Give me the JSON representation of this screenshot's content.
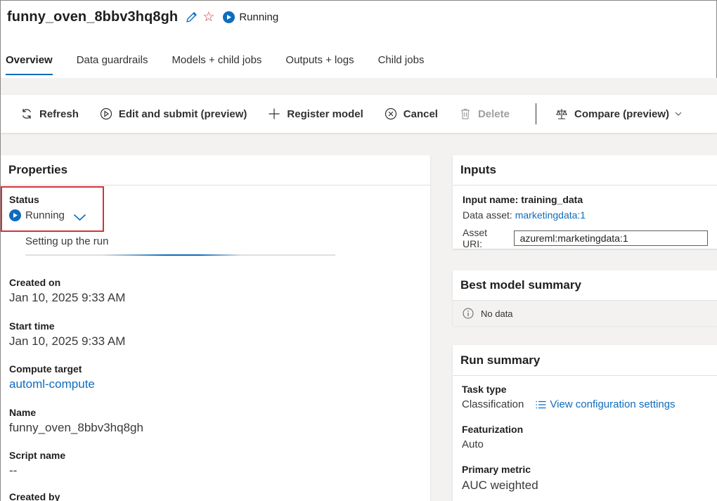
{
  "header": {
    "job_name": "funny_oven_8bbv3hq8gh",
    "status": "Running"
  },
  "tabs": [
    {
      "label": "Overview",
      "active": true
    },
    {
      "label": "Data guardrails",
      "active": false
    },
    {
      "label": "Models + child jobs",
      "active": false
    },
    {
      "label": "Outputs + logs",
      "active": false
    },
    {
      "label": "Child jobs",
      "active": false
    }
  ],
  "toolbar": {
    "refresh": "Refresh",
    "edit_submit": "Edit and submit (preview)",
    "register_model": "Register model",
    "cancel": "Cancel",
    "delete": "Delete",
    "compare": "Compare (preview)"
  },
  "properties": {
    "title": "Properties",
    "status_label": "Status",
    "status_value": "Running",
    "setup_text": "Setting up the run",
    "progress_fraction": 0.45,
    "created_on_label": "Created on",
    "created_on_value": "Jan 10, 2025 9:33 AM",
    "start_time_label": "Start time",
    "start_time_value": "Jan 10, 2025 9:33 AM",
    "compute_label": "Compute target",
    "compute_value": "automl-compute",
    "name_label": "Name",
    "name_value": "funny_oven_8bbv3hq8gh",
    "script_label": "Script name",
    "script_value": "--",
    "created_by_label": "Created by"
  },
  "inputs": {
    "title": "Inputs",
    "input_name": "Input name: training_data",
    "data_asset_label": "Data asset: ",
    "data_asset_link": "marketingdata:1",
    "asset_uri_label": "Asset URI:",
    "asset_uri_value": "azureml:marketingdata:1"
  },
  "best_model": {
    "title": "Best model summary",
    "empty_text": "No data"
  },
  "run_summary": {
    "title": "Run summary",
    "task_type_label": "Task type",
    "task_type_value": "Classification",
    "view_config": "View configuration settings",
    "featurization_label": "Featurization",
    "featurization_value": "Auto",
    "primary_metric_label": "Primary metric",
    "primary_metric_value": "AUC weighted"
  },
  "colors": {
    "accent": "#0f6cbd",
    "highlight_border": "#d13438",
    "star": "#d13438"
  }
}
